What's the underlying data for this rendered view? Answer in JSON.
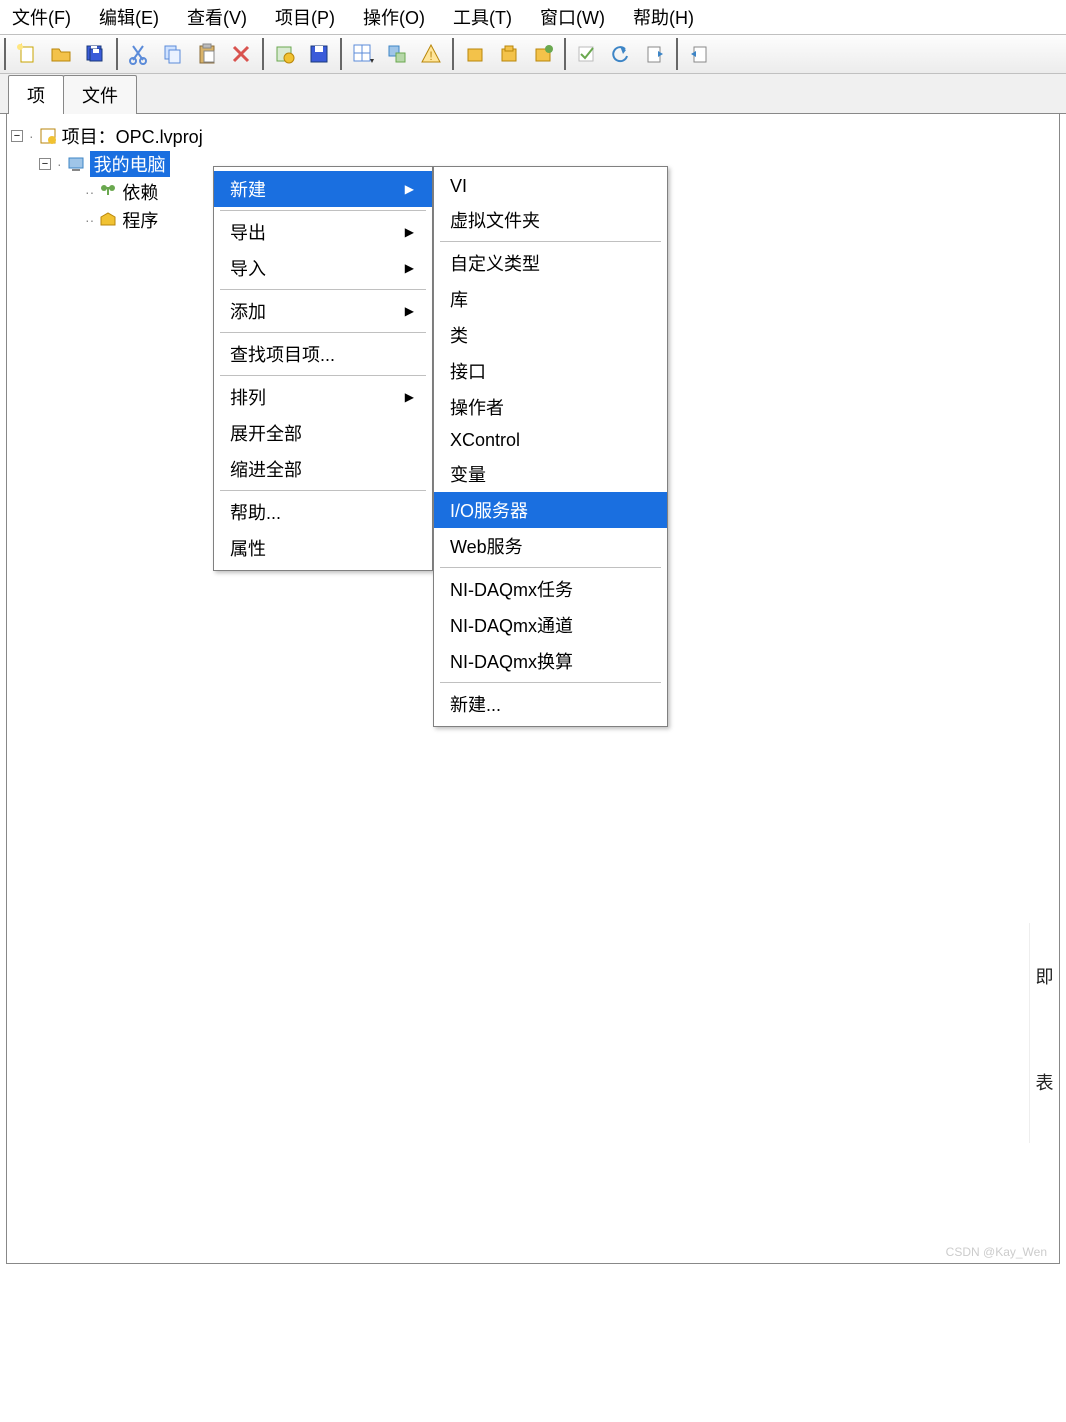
{
  "menubar": {
    "file": "文件(F)",
    "edit": "编辑(E)",
    "view": "查看(V)",
    "project": "项目(P)",
    "operate": "操作(O)",
    "tools": "工具(T)",
    "window": "窗口(W)",
    "help": "帮助(H)"
  },
  "tabs": {
    "project": "项",
    "files": "文件"
  },
  "tree": {
    "root": "项目：OPC.lvproj",
    "my_computer": "我的电脑",
    "dependencies": "依赖",
    "builds": "程序"
  },
  "context_menu": {
    "new": "新建",
    "export": "导出",
    "import": "导入",
    "add": "添加",
    "find": "查找项目项...",
    "arrange": "排列",
    "expand": "展开全部",
    "collapse": "缩进全部",
    "help": "帮助...",
    "properties": "属性"
  },
  "submenu": {
    "vi": "VI",
    "virtual_folder": "虚拟文件夹",
    "custom_type": "自定义类型",
    "library": "库",
    "class": "类",
    "interface": "接口",
    "operator": "操作者",
    "xcontrol": "XControl",
    "variable": "变量",
    "io_server": "I/O服务器",
    "web_service": "Web服务",
    "daq_task": "NI-DAQmx任务",
    "daq_channel": "NI-DAQmx通道",
    "daq_scale": "NI-DAQmx换算",
    "new": "新建..."
  },
  "side": {
    "a": "即",
    "b": "表"
  },
  "watermark": "CSDN @Kay_Wen"
}
